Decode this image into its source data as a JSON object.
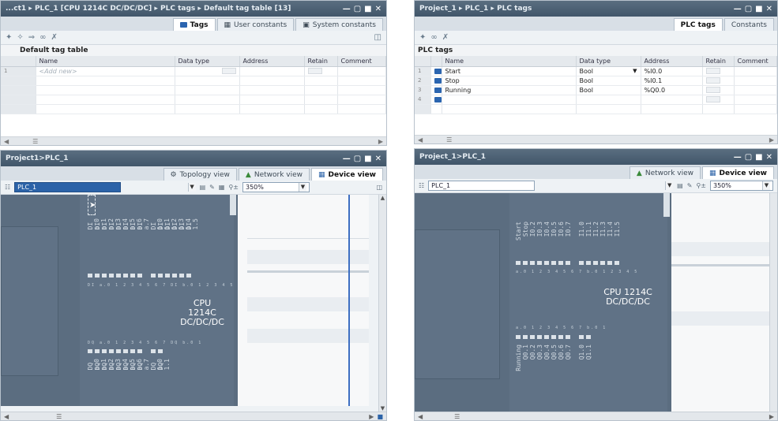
{
  "left": {
    "top_panel": {
      "title": "...ct1 ▸ PLC_1 [CPU 1214C DC/DC/DC] ▸ PLC tags ▸ Default tag table [13]",
      "tabs": [
        "Tags",
        "User constants",
        "System constants"
      ],
      "caption": "Default tag table",
      "columns": [
        "Name",
        "Data type",
        "Address",
        "Retain",
        "Comment"
      ],
      "add_row_placeholder": "<Add new>",
      "row_num": "1"
    },
    "bottom_panel": {
      "title": "Project1>PLC_1",
      "view_tabs": [
        "Topology view",
        "Network view",
        "Device view"
      ],
      "device_select": "PLC_1",
      "zoom": "350%",
      "cpu_name_line1": "CPU 1214C",
      "cpu_name_line2": "DC/DC/DC",
      "input_labels": [
        "DI a.0",
        "DI a.1",
        "DI a.2",
        "DI a.3",
        "DI a.4",
        "DI a.5",
        "DI a.6",
        "DI a.7",
        "DI 1.0",
        "DI 1.1",
        "DI 1.2",
        "DI 1.3",
        "DI 1.4",
        "DI 1.5"
      ],
      "output_labels": [
        "DQ a.0",
        "DQ a.1",
        "DQ a.2",
        "DQ a.3",
        "DQ a.4",
        "DQ a.5",
        "DQ a.6",
        "DQ a.7",
        "DQ 1.0",
        "DQ 1.1"
      ],
      "pin_row_top": "DI a.0 1 2 3 4 5 6 7   DI b.0 1 2 3 4 5",
      "pin_row_bottom": "DQ a.0 1 2 3 4 5 6 7   DQ b.0 1"
    }
  },
  "right": {
    "top_panel": {
      "title": "Project_1 ▸ PLC_1 ▸ PLC tags",
      "tabs": [
        "PLC tags",
        "Constants"
      ],
      "caption": "PLC tags",
      "columns": [
        "Name",
        "Data type",
        "Address",
        "Retain",
        "Comment"
      ],
      "rows": [
        {
          "num": "1",
          "name": "Start",
          "type": "Bool",
          "address": "%I0.0"
        },
        {
          "num": "2",
          "name": "Stop",
          "type": "Bool",
          "address": "%I0.1"
        },
        {
          "num": "3",
          "name": "Running",
          "type": "Bool",
          "address": "%Q0.0"
        },
        {
          "num": "4",
          "name": "",
          "type": "",
          "address": ""
        }
      ]
    },
    "bottom_panel": {
      "title": "Project_1>PLC_1",
      "view_tabs": [
        "Network view",
        "Device view"
      ],
      "device_select": "PLC_1",
      "zoom": "350%",
      "cpu_name_line1": "CPU 1214C",
      "cpu_name_line2": "DC/DC/DC",
      "input_labels": [
        "Start",
        "Stop",
        "I0.2",
        "I0.3",
        "I0.4",
        "I0.5",
        "I0.6",
        "I0.7",
        "I1.0",
        "I1.1",
        "I1.2",
        "I1.3",
        "I1.4",
        "I1.5"
      ],
      "output_labels": [
        "Running",
        "Q0.1",
        "Q0.2",
        "Q0.3",
        "Q0.4",
        "Q0.5",
        "Q0.6",
        "Q0.7",
        "Q1.0",
        "Q1.1"
      ],
      "pin_row_top": "a.0 1 2 3 4 5 6 7   b.0 1 2 3 4 5",
      "pin_row_bottom": "a.0 1 2 3 4 5 6 7   b.0 1"
    }
  },
  "colors": {
    "titlebar": "#4b5f73",
    "canvas": "#5b6d80",
    "selection": "#2c63a8"
  }
}
